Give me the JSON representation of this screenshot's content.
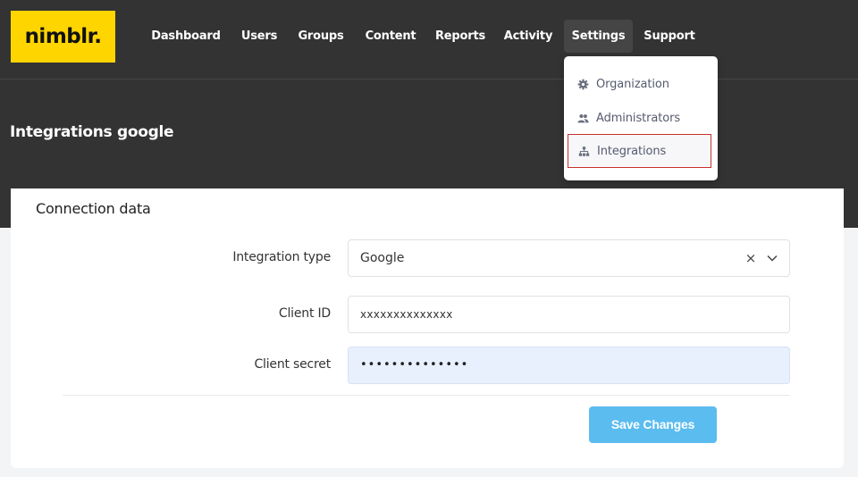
{
  "brand": {
    "logo_text": "nimblr.",
    "logo_color": "#ffd500"
  },
  "nav": {
    "items": [
      "Dashboard",
      "Users",
      "Groups",
      "Content",
      "Reports",
      "Activity",
      "Settings",
      "Support"
    ],
    "active": "Settings"
  },
  "settings_menu": {
    "items": [
      {
        "label": "Organization",
        "icon": "gear-icon"
      },
      {
        "label": "Administrators",
        "icon": "users-icon"
      },
      {
        "label": "Integrations",
        "icon": "sitemap-icon",
        "selected": true
      }
    ]
  },
  "page": {
    "title": "Integrations google"
  },
  "form": {
    "section_title": "Connection data",
    "integration_type": {
      "label": "Integration type",
      "value": "Google"
    },
    "client_id": {
      "label": "Client ID",
      "value": "xxxxxxxxxxxxxx"
    },
    "client_secret": {
      "label": "Client secret",
      "value": "••••••••••••••"
    },
    "save_label": "Save Changes"
  },
  "colors": {
    "header_bg": "#333333",
    "accent_button": "#5bbcf0",
    "selected_outline": "#c9302c",
    "autofill_bg": "#e8f0fe"
  }
}
